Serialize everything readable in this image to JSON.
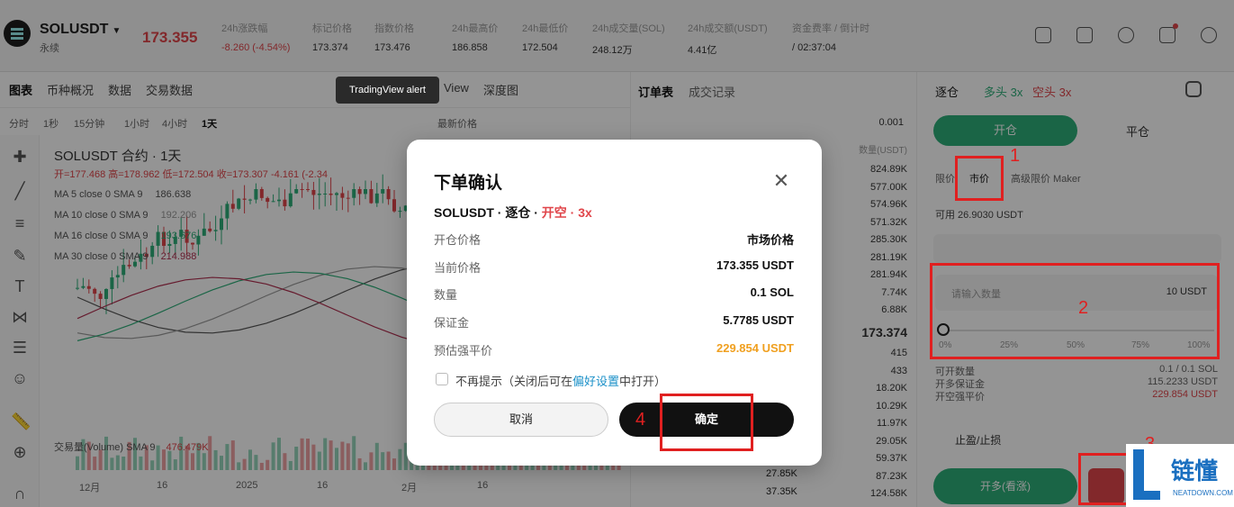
{
  "header": {
    "symbol": "SOLUSDT",
    "symbol_sub": "永续",
    "last_price": "173.355",
    "stats": [
      {
        "label": "24h涨跌幅",
        "value": "-8.260 (-4.54%)",
        "color": "red"
      },
      {
        "label": "标记价格",
        "value": "173.374"
      },
      {
        "label": "指数价格",
        "value": "173.476"
      },
      {
        "label": "24h最高价",
        "value": "186.858"
      },
      {
        "label": "24h最低价",
        "value": "172.504"
      },
      {
        "label": "24h成交量(SOL)",
        "value": "248.12万"
      },
      {
        "label": "24h成交额(USDT)",
        "value": "4.41亿"
      },
      {
        "label": "资金费率 / 倒计时",
        "value": "/ 02:37:04"
      }
    ]
  },
  "chart_tabs": [
    "图表",
    "币种概况",
    "数据",
    "交易数据"
  ],
  "chart_tab_extra": [
    "View",
    "深度图"
  ],
  "chart_tools": [
    "分时",
    "1秒",
    "15分钟",
    "1小时",
    "4小时",
    "1天"
  ],
  "chart_tools_extra": [
    "最新价格"
  ],
  "chart": {
    "title": "SOLUSDT 合约 · 1天",
    "ohlc": "开=177.468 高=178.962 低=172.504 收=173.307 -4.161 (-2.34",
    "ma": [
      {
        "label": "MA 5 close 0 SMA 9",
        "value": "186.638",
        "color": "#555555"
      },
      {
        "label": "MA 10 close 0 SMA 9",
        "value": "192.206",
        "color": "#999999"
      },
      {
        "label": "MA 16 close 0 SMA 9",
        "value": "193.676",
        "color": "#2eae79"
      },
      {
        "label": "MA 30 close 0 SMA 9",
        "value": "214.988",
        "color": "#b03050"
      }
    ],
    "volume_label": "交易量(Volume) SMA 9",
    "volume_value": "476.479K",
    "x_ticks": [
      "12月",
      "16",
      "2025",
      "16",
      "2月",
      "16"
    ]
  },
  "orderbook": {
    "tabs": [
      "订单表",
      "成交记录"
    ],
    "precision": "0.001",
    "col_header": "数量(USDT)",
    "asks": [
      "824.89K",
      "577.00K",
      "574.96K",
      "571.32K",
      "285.30K",
      "281.19K",
      "281.94K",
      "7.74K",
      "6.88K"
    ],
    "mid": "173.374",
    "bids": [
      "415",
      "433",
      "18.20K",
      "10.29K",
      "11.97K",
      "29.05K",
      "59.37K",
      "87.23K",
      "124.58K"
    ],
    "bottom_left": [
      "27.85K",
      "37.35K"
    ]
  },
  "panel": {
    "margin_mode": "逐仓",
    "lev_long": "多头 3x",
    "lev_short": "空头 3x",
    "open_label": "开仓",
    "close_label": "平仓",
    "order_types": [
      "限价",
      "市价",
      "高级限价 Maker"
    ],
    "available": "可用 26.9030 USDT",
    "qty_placeholder": "请输入数量",
    "qty_unit": "10 USDT",
    "slider_ticks": [
      "0%",
      "25%",
      "50%",
      "75%",
      "100%"
    ],
    "info": [
      {
        "label": "可开数量",
        "value": "0.1 / 0.1 SOL"
      },
      {
        "label": "开多保证金",
        "value": "115.2233 USDT"
      },
      {
        "label": "开空强平价",
        "value": "229.854 USDT"
      }
    ],
    "tpsl": "止盈/止损",
    "buy_label": "开多(看涨)"
  },
  "tooltip": "TradingView alert",
  "modal": {
    "title": "下单确认",
    "sub_symbol": "SOLUSDT · 逐仓 · ",
    "sub_side": "开空 · 3x",
    "rows": [
      {
        "label": "开仓价格",
        "value": "市场价格"
      },
      {
        "label": "当前价格",
        "value": "173.355 USDT"
      },
      {
        "label": "数量",
        "value": "0.1 SOL"
      },
      {
        "label": "保证金",
        "value": "5.7785 USDT"
      },
      {
        "label": "预估强平价",
        "value": "229.854 USDT"
      }
    ],
    "dont_remind": "不再提示（关闭后可在",
    "pref_link": "偏好设置",
    "dont_remind_end": "中打开）",
    "cancel": "取消",
    "confirm": "确定"
  },
  "annotations": [
    "1",
    "2",
    "3",
    "4"
  ],
  "watermark": {
    "brand": "链懂",
    "site": "NEATDOWN.COM"
  }
}
